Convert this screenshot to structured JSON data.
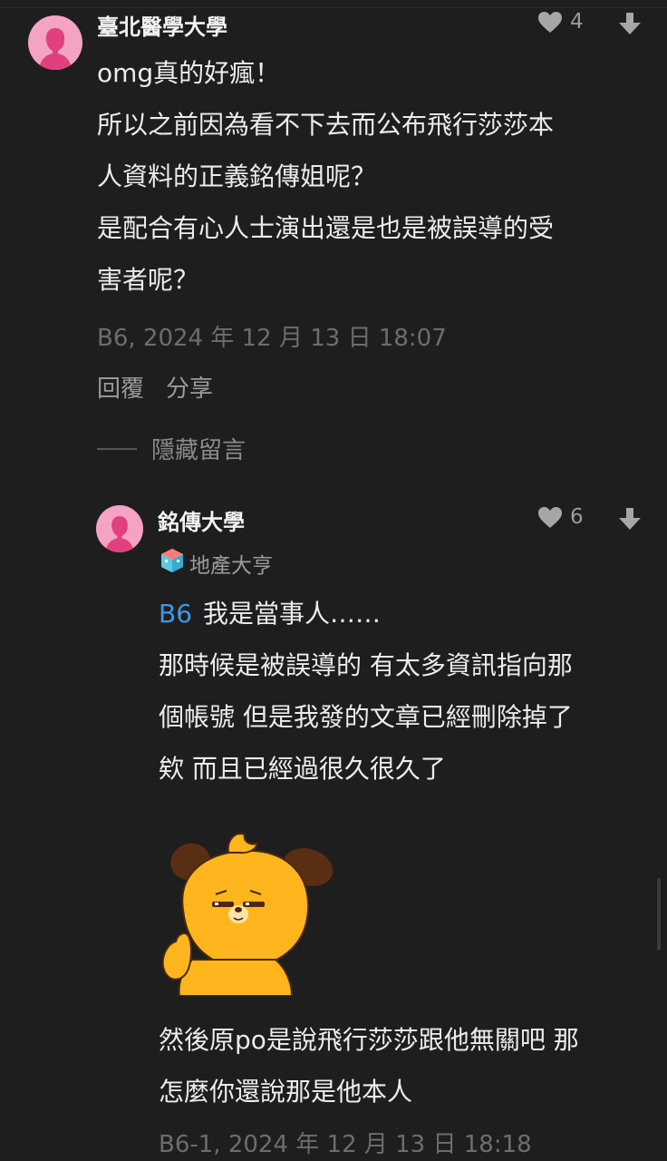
{
  "comment": {
    "author": "臺北醫學大學",
    "likes": "4",
    "lines": [
      "omg真的好瘋！",
      "所以之前因為看不下去而公布飛行莎莎本",
      "人資料的正義銘傳姐呢？",
      "是配合有心人士演出還是也是被誤導的受",
      "害者呢？"
    ],
    "meta": "B6, 2024 年 12 月 13 日 18:07",
    "reply_label": "回覆",
    "share_label": "分享",
    "hide_label": "隱藏留言"
  },
  "reply": {
    "author": "銘傳大學",
    "badge": "地產大亨",
    "likes": "6",
    "reply_to": "B6",
    "first_line": "我是當事人……",
    "lines": [
      "那時候是被誤導的 有太多資訊指向那",
      "個帳號 但是我發的文章已經刪除掉了",
      "欸 而且已經過很久很久了"
    ],
    "lines_after": [
      "然後原po是說飛行莎莎跟他無關吧 那",
      "怎麼你還說那是他本人"
    ],
    "meta": "B6-1, 2024 年 12 月 13 日 18:18"
  },
  "colors": {
    "background": "#1e1e1e",
    "avatar": "#f4a3c4",
    "link": "#3f97e6",
    "sticker": "#ffb61e"
  },
  "icons": [
    "heart-icon",
    "downvote-icon",
    "badge-icon",
    "avatar-silhouette-icon"
  ]
}
